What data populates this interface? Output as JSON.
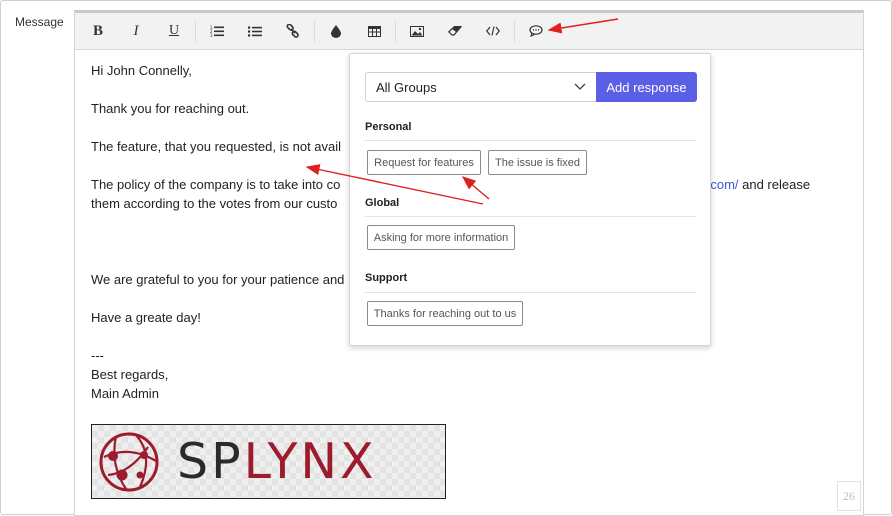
{
  "field_label": "Message",
  "toolbar": {
    "buttons": [
      {
        "name": "bold-button",
        "glyph": "B"
      },
      {
        "name": "italic-button",
        "glyph": "I"
      },
      {
        "name": "underline-button",
        "glyph": "U"
      },
      {
        "name": "ordered-list-button",
        "icon": "ordered-list-icon"
      },
      {
        "name": "unordered-list-button",
        "icon": "unordered-list-icon"
      },
      {
        "name": "link-button",
        "icon": "link-icon"
      },
      {
        "name": "color-button",
        "icon": "droplet-icon"
      },
      {
        "name": "table-button",
        "icon": "table-icon"
      },
      {
        "name": "image-button",
        "icon": "image-icon"
      },
      {
        "name": "eraser-button",
        "icon": "eraser-icon"
      },
      {
        "name": "code-button",
        "icon": "code-icon"
      },
      {
        "name": "responses-button",
        "icon": "speech-bubble-icon"
      }
    ]
  },
  "message": {
    "greeting": "Hi John Connelly,",
    "thanks": "Thank you for reaching out.",
    "feature": "The feature, that you requested, is not avail",
    "policy_start": "The policy of the company is to take into co",
    "policy_link": "nx.com/",
    "policy_end": " and release",
    "policy_line2": "them according to the votes from our custo",
    "grateful": "We are grateful to you for your patience and",
    "greate_day": "Have a greate day!",
    "dashes": "---",
    "regards": "Best regards,",
    "signature": "Main Admin"
  },
  "logo": {
    "part1": "SP",
    "part2": "LYNX",
    "brand_color": "#9c1b2c"
  },
  "char_count": "26",
  "responses_popup": {
    "group_select": {
      "value": "All Groups"
    },
    "add_button": "Add response",
    "sections": [
      {
        "title": "Personal",
        "items": [
          "Request for features",
          "The issue is fixed"
        ]
      },
      {
        "title": "Global",
        "items": [
          "Asking for more information"
        ]
      },
      {
        "title": "Support",
        "items": [
          "Thanks for reaching out to us"
        ]
      }
    ]
  },
  "colors": {
    "accent": "#5b5fe8",
    "annotation_arrow": "#e02020",
    "link": "#3b5bd9"
  }
}
